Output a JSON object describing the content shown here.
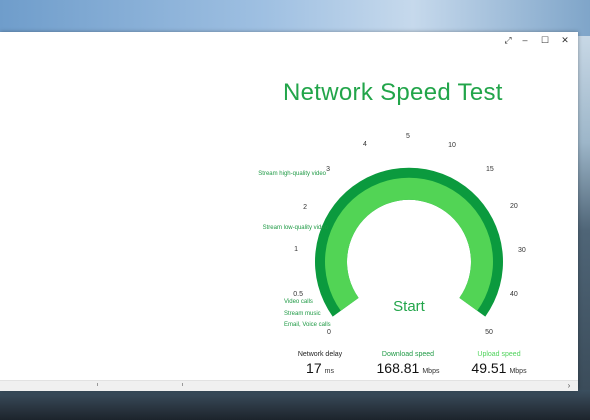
{
  "window": {
    "buttons": {
      "restore": "⤢",
      "minimize": "–",
      "maximize": "☐",
      "close": "✕"
    }
  },
  "app": {
    "title": "Network Speed Test"
  },
  "gauge": {
    "scale_labels": [
      "0",
      "0.5",
      "1",
      "2",
      "3",
      "4",
      "5",
      "10",
      "15",
      "20",
      "30",
      "40",
      "50"
    ],
    "categories": [
      "Stream high-quality video",
      "Stream low-quality video",
      "Video calls",
      "Stream music",
      "Email, Voice calls"
    ],
    "start_label": "Start",
    "colors": {
      "outer": "#0b9a3e",
      "inner": "#52d455",
      "text": "#22a54a"
    }
  },
  "stats": {
    "delay": {
      "label": "Network delay",
      "value": "17",
      "unit": "ms"
    },
    "download": {
      "label": "Download speed",
      "value": "168.81",
      "unit": "Mbps"
    },
    "upload": {
      "label": "Upload speed",
      "value": "49.51",
      "unit": "Mbps"
    }
  },
  "scrollbar": {
    "right_arrow": "›"
  }
}
